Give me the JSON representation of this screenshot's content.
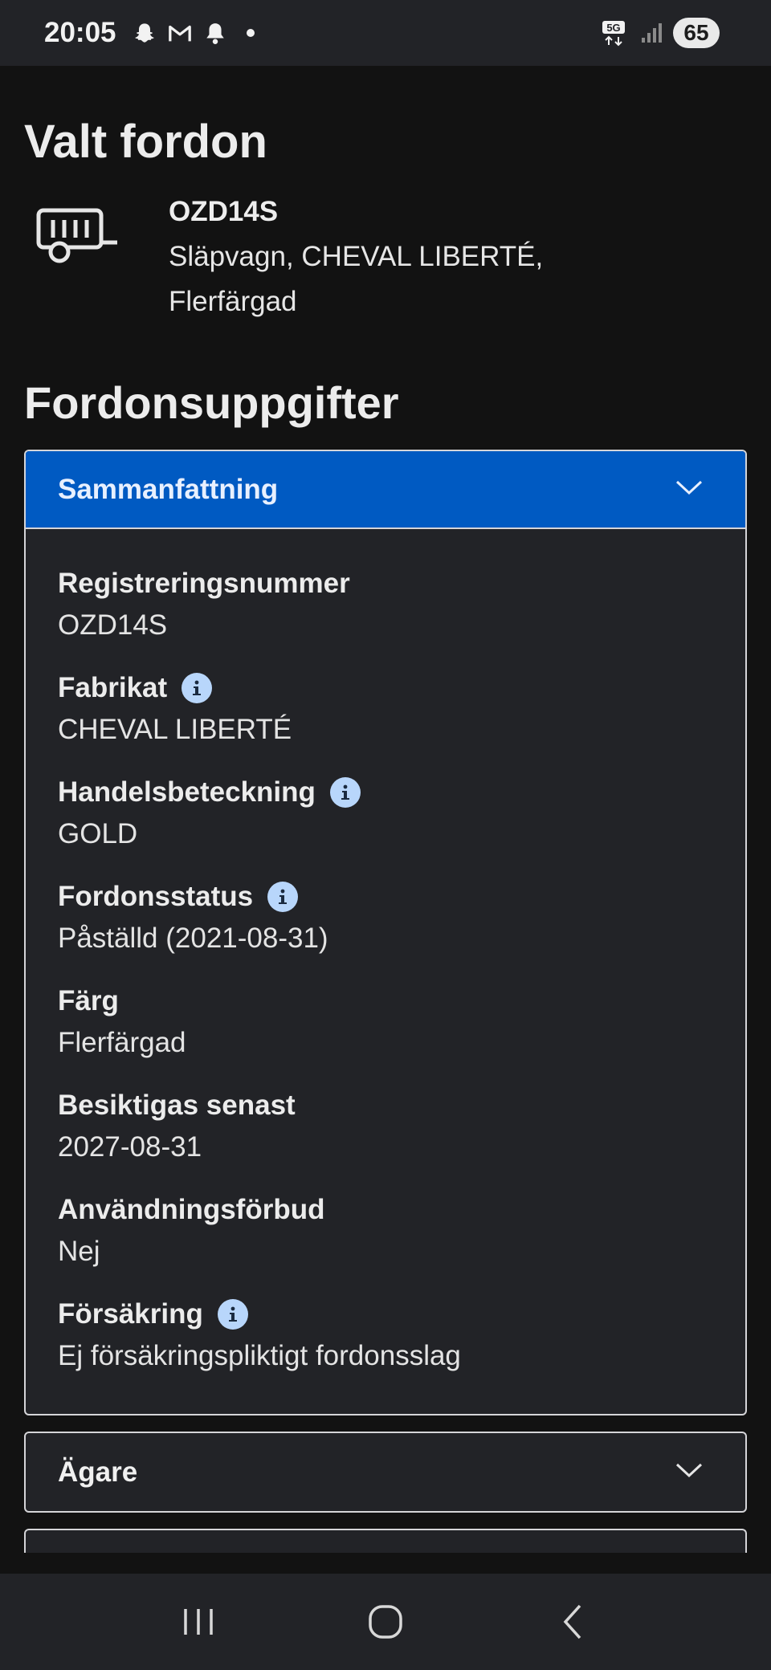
{
  "status_bar": {
    "time": "20:05",
    "left_icons": [
      "snapchat-icon",
      "gmail-icon",
      "bell-icon",
      "dot-icon"
    ],
    "network": "5G",
    "battery": "65"
  },
  "page": {
    "title": "Valt fordon",
    "vehicle": {
      "icon": "trailer-icon",
      "reg": "OZD14S",
      "description": "Släpvagn, CHEVAL LIBERTÉ, Flerfärgad"
    },
    "section_title": "Fordonsuppgifter"
  },
  "summary": {
    "title": "Sammanfattning",
    "fields": [
      {
        "label": "Registreringsnummer",
        "value": "OZD14S",
        "info": false
      },
      {
        "label": "Fabrikat",
        "value": "CHEVAL LIBERTÉ",
        "info": true
      },
      {
        "label": "Handelsbeteckning",
        "value": "GOLD",
        "info": true
      },
      {
        "label": "Fordonsstatus",
        "value": "Påställd (2021-08-31)",
        "info": true
      },
      {
        "label": "Färg",
        "value": "Flerfärgad",
        "info": false
      },
      {
        "label": "Besiktigas senast",
        "value": "2027-08-31",
        "info": false
      },
      {
        "label": "Användningsförbud",
        "value": "Nej",
        "info": false
      },
      {
        "label": "Försäkring",
        "value": "Ej försäkringspliktigt fordonsslag",
        "info": true
      }
    ]
  },
  "owner": {
    "title": "Ägare"
  },
  "colors": {
    "accent": "#005ac2",
    "info_bg": "#b8d6fb",
    "panel": "#222327"
  },
  "nav": [
    "recent-apps-icon",
    "home-icon",
    "back-icon"
  ]
}
